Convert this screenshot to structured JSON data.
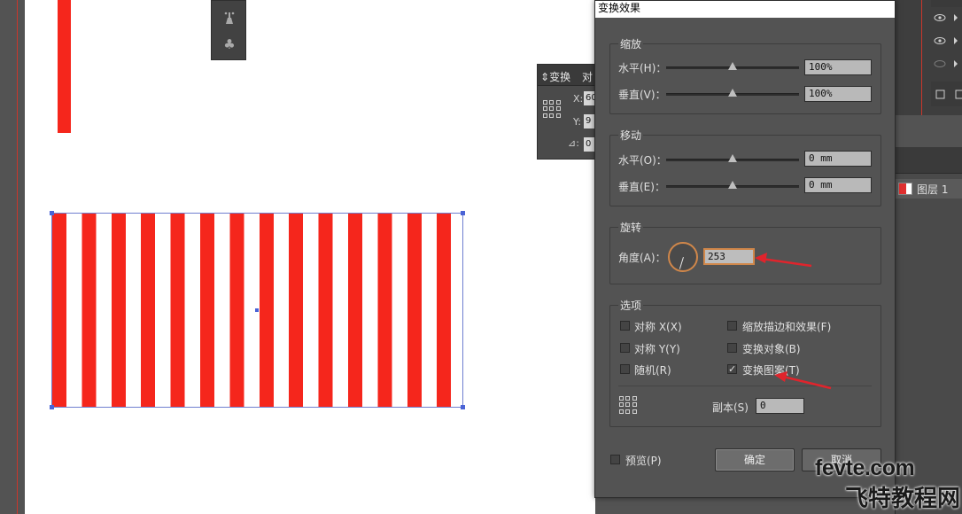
{
  "dialog": {
    "title": "变换效果",
    "scale": {
      "group_label": "缩放",
      "horizontal_label": "水平(H)：",
      "horizontal_value": "100%",
      "vertical_label": "垂直(V)：",
      "vertical_value": "100%"
    },
    "move": {
      "group_label": "移动",
      "horizontal_label": "水平(O)：",
      "horizontal_value": "0 mm",
      "vertical_label": "垂直(E)：",
      "vertical_value": "0 mm"
    },
    "rotate": {
      "group_label": "旋转",
      "angle_label": "角度(A)：",
      "angle_value": "253"
    },
    "options": {
      "group_label": "选项",
      "reflect_x": "对称 X(X)",
      "reflect_y": "对称 Y(Y)",
      "random": "随机(R)",
      "scale_strokes": "缩放描边和效果(F)",
      "transform_objects": "变换对象(B)",
      "transform_patterns": "变换图案(T)",
      "transform_patterns_checked": true,
      "copies_label": "副本(S)",
      "copies_value": "0"
    },
    "preview_label": "预览(P)",
    "ok_label": "确定",
    "cancel_label": "取消"
  },
  "transform_panel": {
    "tab_label": "变换",
    "tab2_label": "对",
    "x_label": "X:",
    "x_value": "60",
    "y_label": "Y:",
    "y_value": "9",
    "angle_value": "0"
  },
  "layers": {
    "layer_name": "图层 1"
  },
  "watermark": {
    "domain": "fevte.com",
    "cn": "飞特教程网"
  },
  "colors": {
    "stripe_red": "#f5261c",
    "annotation_arrow": "#e0242c",
    "focus_orange": "#d0874a"
  }
}
